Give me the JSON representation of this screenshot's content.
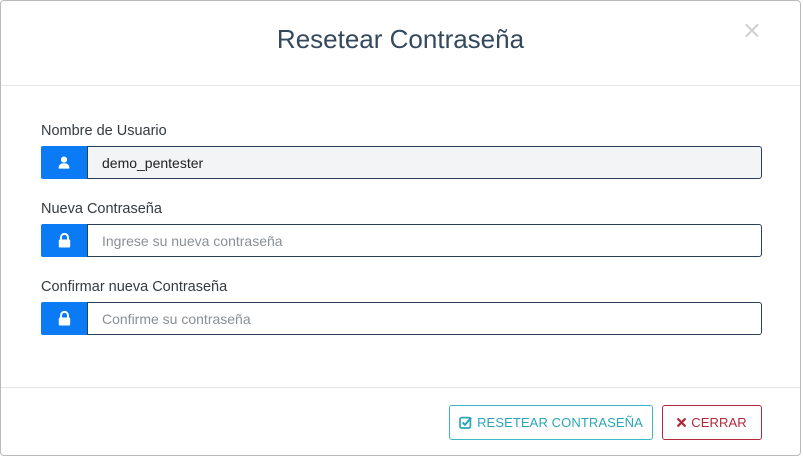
{
  "modal": {
    "title": "Resetear Contraseña",
    "close_glyph": "×"
  },
  "fields": {
    "username": {
      "label": "Nombre de Usuario",
      "value": "demo_pentester",
      "icon": "user-icon"
    },
    "new_password": {
      "label": "Nueva Contraseña",
      "placeholder": "Ingrese su nueva contraseña",
      "icon": "lock-icon"
    },
    "confirm_password": {
      "label": "Confirmar nueva Contraseña",
      "placeholder": "Confirme su contraseña",
      "icon": "lock-icon"
    }
  },
  "buttons": {
    "reset_label": "RESETEAR CONTRASEÑA",
    "reset_icon": "check-square-icon",
    "close_label": "CERRAR",
    "close_icon": "x-icon"
  },
  "colors": {
    "addon": "#0a7bf5",
    "title": "#34495e",
    "reset": "#2aa6b8",
    "close": "#b4283c"
  }
}
